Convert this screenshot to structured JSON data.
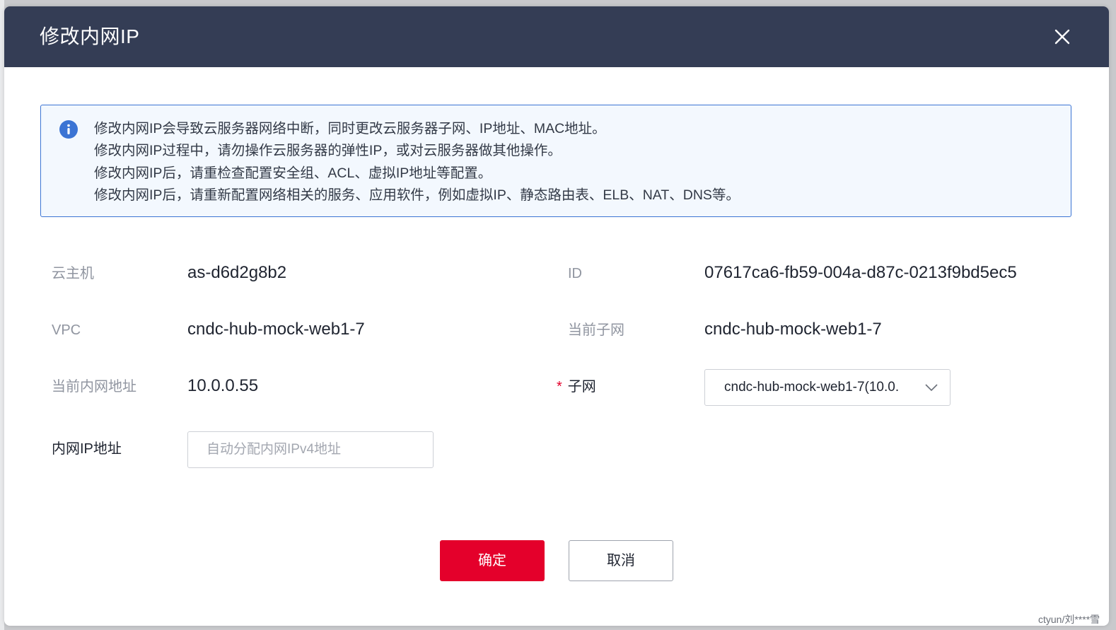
{
  "dialog": {
    "title": "修改内网IP",
    "close_icon": "close-icon"
  },
  "notice": {
    "icon": "info-icon",
    "accent_color": "#3b74d4",
    "lines": [
      "修改内网IP会导致云服务器网络中断，同时更改云服务器子网、IP地址、MAC地址。",
      "修改内网IP过程中，请勿操作云服务器的弹性IP，或对云服务器做其他操作。",
      "修改内网IP后，请重检查配置安全组、ACL、虚拟IP地址等配置。",
      "修改内网IP后，请重新配置网络相关的服务、应用软件，例如虚拟IP、静态路由表、ELB、NAT、DNS等。"
    ]
  },
  "fields": {
    "host_label": "云主机",
    "host_value": "as-d6d2g8b2",
    "id_label": "ID",
    "id_value": "07617ca6-fb59-004a-d87c-0213f9bd5ec5",
    "vpc_label": "VPC",
    "vpc_value": "cndc-hub-mock-web1-7",
    "current_subnet_label": "当前子网",
    "current_subnet_value": "cndc-hub-mock-web1-7",
    "current_ip_label": "当前内网地址",
    "current_ip_value": "10.0.0.55",
    "subnet_required_mark": "*",
    "subnet_label": "子网",
    "subnet_selected": "cndc-hub-mock-web1-7(10.0.",
    "ip_label": "内网IP地址",
    "ip_value": "",
    "ip_placeholder": "自动分配内网IPv4地址"
  },
  "actions": {
    "confirm_label": "确定",
    "cancel_label": "取消",
    "primary_color": "#e4002b"
  },
  "watermark": "ctyun/刘****雪",
  "header_color": "#343d55"
}
